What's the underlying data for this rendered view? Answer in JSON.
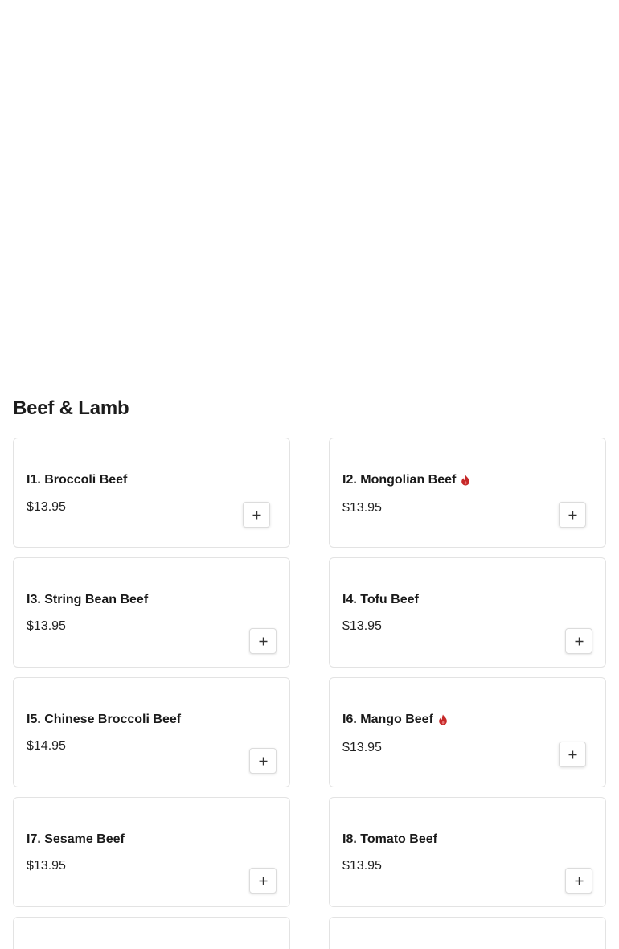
{
  "section": {
    "title": "Beef & Lamb"
  },
  "colors": {
    "spicy": "#c62828",
    "border": "#e3e3e3",
    "text": "#1a1a1a"
  },
  "items": [
    {
      "name": "I1. Broccoli Beef",
      "price": "$13.95",
      "spicy": false,
      "icon": "plus-icon"
    },
    {
      "name": "I2. Mongolian Beef",
      "price": "$13.95",
      "spicy": true,
      "icon": "plus-icon"
    },
    {
      "name": "I3. String Bean Beef",
      "price": "$13.95",
      "spicy": false,
      "icon": "plus-icon"
    },
    {
      "name": "I4. Tofu Beef",
      "price": "$13.95",
      "spicy": false,
      "icon": "plus-icon"
    },
    {
      "name": "I5. Chinese Broccoli Beef",
      "price": "$14.95",
      "spicy": false,
      "icon": "plus-icon"
    },
    {
      "name": "I6. Mango Beef",
      "price": "$13.95",
      "spicy": true,
      "icon": "plus-icon"
    },
    {
      "name": "I7. Sesame Beef",
      "price": "$13.95",
      "spicy": false,
      "icon": "plus-icon"
    },
    {
      "name": "I8. Tomato Beef",
      "price": "$13.95",
      "spicy": false,
      "icon": "plus-icon"
    }
  ]
}
